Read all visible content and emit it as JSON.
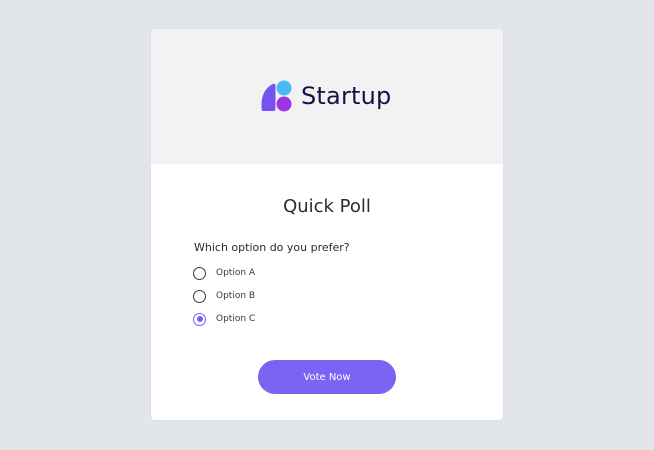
{
  "brand": {
    "name": "Startup",
    "logo_icon": "startup-logo-icon",
    "colors": {
      "leaf": "#7653f1",
      "dot_top": "#48b9f5",
      "dot_bottom": "#9d32e8",
      "text": "#15124b"
    }
  },
  "poll": {
    "title": "Quick Poll",
    "question": "Which option do you prefer?",
    "options": [
      {
        "label": "Option A",
        "selected": false
      },
      {
        "label": "Option B",
        "selected": false
      },
      {
        "label": "Option C",
        "selected": true
      }
    ],
    "submit_label": "Vote Now"
  },
  "colors": {
    "background": "#e2e6ea",
    "card": "#ffffff",
    "header": "#f2f2f2",
    "accent": "#7b63f3"
  }
}
